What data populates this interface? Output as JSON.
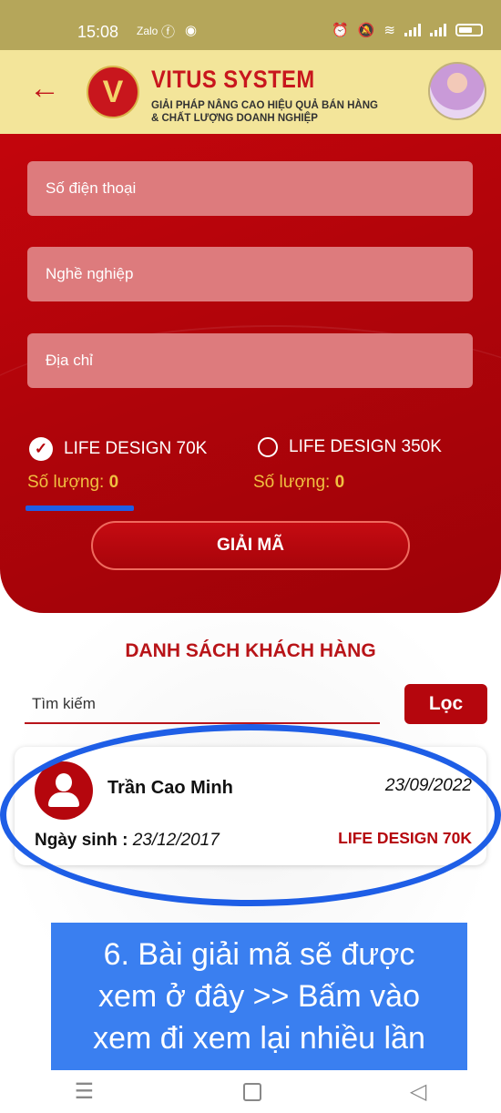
{
  "status_bar": {
    "time": "15:08",
    "notif_icons": [
      "zalo-icon",
      "facebook-icon",
      "messenger-icon"
    ],
    "right_icons": [
      "alarm-icon",
      "mute-icon",
      "wifi-icon",
      "signal-icon",
      "signal-icon",
      "battery-icon"
    ],
    "zalo_label": "Zalo"
  },
  "header": {
    "brand": "VITUS SYSTEM",
    "tagline_line1": "GIẢI PHÁP NÂNG CAO HIỆU QUẢ BÁN HÀNG",
    "tagline_line2": "& CHẤT LƯỢNG DOANH NGHIỆP",
    "back_icon": "arrow-left-icon",
    "logo_glyph": "V",
    "colors": {
      "brand": "#c8161d",
      "header_bg": "#f3e59a"
    }
  },
  "form": {
    "phone_placeholder": "Số điện thoại",
    "job_placeholder": "Nghề nghiệp",
    "address_placeholder": "Địa chỉ",
    "packages": [
      {
        "label": "LIFE DESIGN 70K",
        "selected": true,
        "qty_label": "Số lượng:",
        "qty": "0"
      },
      {
        "label": "LIFE DESIGN 350K",
        "selected": false,
        "qty_label": "Số lượng:",
        "qty": "0"
      }
    ],
    "decode_button": "GIẢI MÃ",
    "colors": {
      "panel": "#b5050b",
      "qty": "#f0c040"
    }
  },
  "list": {
    "title": "DANH SÁCH KHÁCH HÀNG",
    "search_placeholder": "Tìm kiếm",
    "filter_button": "Lọc",
    "customers": [
      {
        "name": "Trần Cao Minh",
        "date": "23/09/2022",
        "dob_label": "Ngày sinh :",
        "dob": "23/12/2017",
        "package": "LIFE DESIGN 70K"
      }
    ]
  },
  "annotation": {
    "text_line1": "6. Bài giải mã sẽ được",
    "text_line2": "xem ở đây >> Bấm vào",
    "text_line3": "xem đi xem lại nhiều lần",
    "color": "#3a7ff0",
    "highlight_color": "#1e5ee6"
  },
  "nav": {
    "icons": [
      "menu-icon",
      "home-icon",
      "back-triangle-icon"
    ]
  }
}
